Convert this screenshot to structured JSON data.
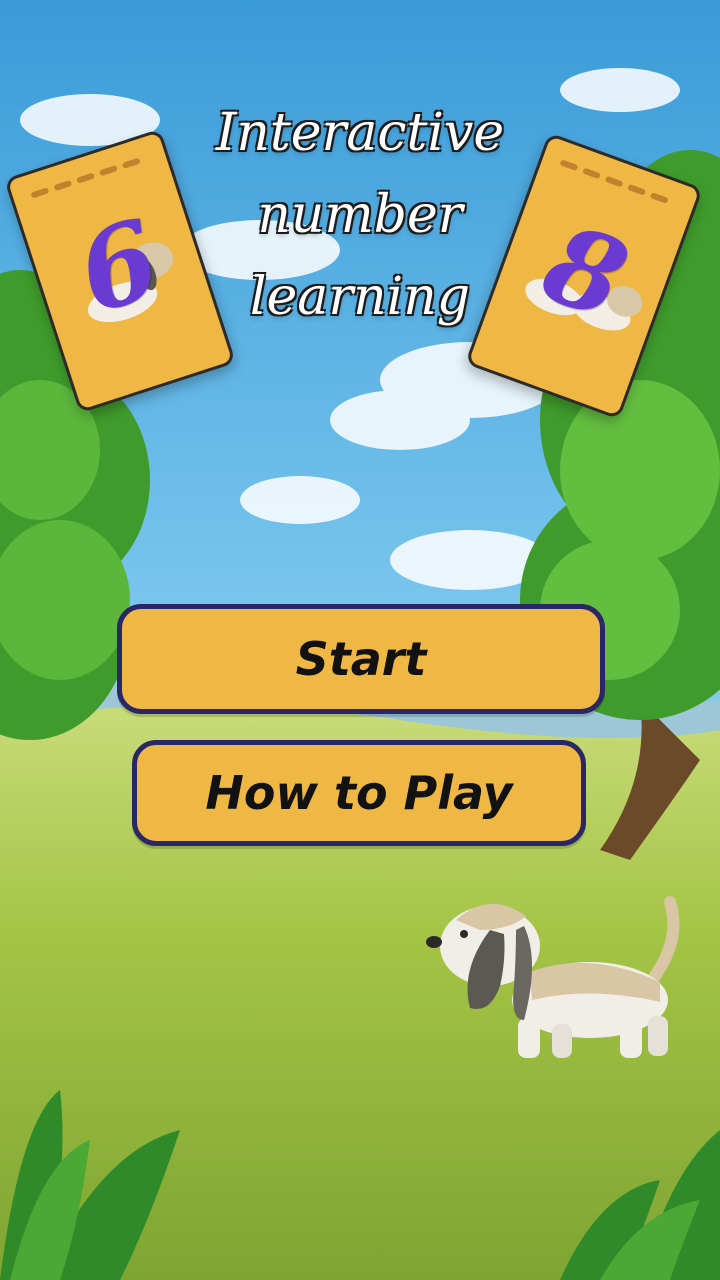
{
  "title": {
    "line1": "Interactive",
    "line2": "number",
    "line3": "learning"
  },
  "cards": [
    {
      "digit": "6"
    },
    {
      "digit": "8"
    }
  ],
  "buttons": {
    "start_label": "Start",
    "how_to_play_label": "How to Play"
  },
  "colors": {
    "card": "#efb744",
    "button": "#efb744",
    "button_border": "#2a2766",
    "digit": "#6a3ad1",
    "sky": "#4fb3e6",
    "grass": "#a7c94a"
  }
}
